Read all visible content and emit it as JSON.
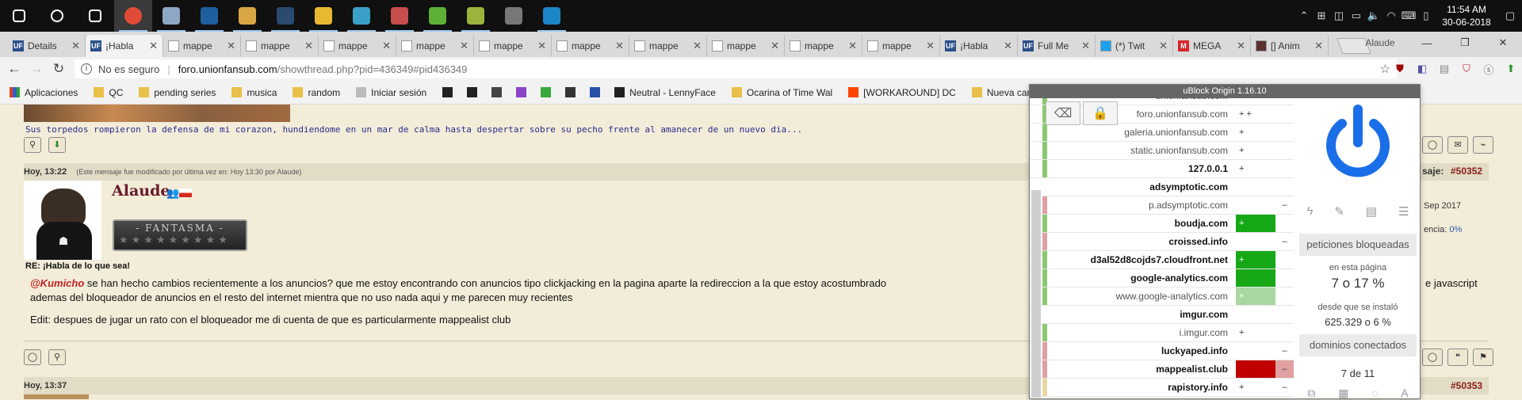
{
  "taskbar": {
    "apps": [
      {
        "icon": "windows-start-icon",
        "color": "#ffffff"
      },
      {
        "icon": "search-icon",
        "color": "#ffffff"
      },
      {
        "icon": "task-view-icon",
        "color": "#ffffff"
      },
      {
        "icon": "chrome-icon",
        "color": "#e04b36"
      },
      {
        "icon": "app-icon",
        "color": "#8fa7c6"
      },
      {
        "icon": "app-icon",
        "color": "#1f5fa0"
      },
      {
        "icon": "paint-icon",
        "color": "#d9a645"
      },
      {
        "icon": "steam-icon",
        "color": "#2a4a6e"
      },
      {
        "icon": "explorer-icon",
        "color": "#e8b930"
      },
      {
        "icon": "app-icon",
        "color": "#3ba0c8"
      },
      {
        "icon": "app-icon",
        "color": "#c84d4d"
      },
      {
        "icon": "utorrent-icon",
        "color": "#5db037"
      },
      {
        "icon": "app-icon",
        "color": "#9ab43c"
      },
      {
        "icon": "app-icon",
        "color": "#777777"
      },
      {
        "icon": "app-icon",
        "color": "#1a86c8"
      }
    ],
    "clock": {
      "time": "11:54 AM",
      "date": "30-06-2018"
    }
  },
  "tabs": [
    {
      "label": "Details",
      "fav": "UF",
      "fav_color": "#2b4f8a",
      "active": false
    },
    {
      "label": "¡Habla",
      "fav": "UF",
      "fav_color": "#2b4f8a",
      "active": true
    },
    {
      "label": "mappe",
      "fav": "",
      "fav_color": "#ffffff",
      "active": false
    },
    {
      "label": "mappe",
      "fav": "",
      "fav_color": "#ffffff",
      "active": false
    },
    {
      "label": "mappe",
      "fav": "",
      "fav_color": "#ffffff",
      "active": false
    },
    {
      "label": "mappe",
      "fav": "",
      "fav_color": "#ffffff",
      "active": false
    },
    {
      "label": "mappe",
      "fav": "",
      "fav_color": "#ffffff",
      "active": false
    },
    {
      "label": "mappe",
      "fav": "",
      "fav_color": "#ffffff",
      "active": false
    },
    {
      "label": "mappe",
      "fav": "",
      "fav_color": "#ffffff",
      "active": false
    },
    {
      "label": "mappe",
      "fav": "",
      "fav_color": "#ffffff",
      "active": false
    },
    {
      "label": "mappe",
      "fav": "",
      "fav_color": "#ffffff",
      "active": false
    },
    {
      "label": "mappe",
      "fav": "",
      "fav_color": "#ffffff",
      "active": false
    },
    {
      "label": "¡Habla",
      "fav": "UF",
      "fav_color": "#2b4f8a",
      "active": false
    },
    {
      "label": "Full Me",
      "fav": "UF",
      "fav_color": "#2b4f8a",
      "active": false
    },
    {
      "label": "(*) Twit",
      "fav": "",
      "fav_color": "#1da1f2",
      "active": false
    },
    {
      "label": "MEGA",
      "fav": "M",
      "fav_color": "#d9272e",
      "active": false
    },
    {
      "label": "[] Anim",
      "fav": "",
      "fav_color": "#5a3030",
      "active": false
    }
  ],
  "window": {
    "profile": "Alaude"
  },
  "address": {
    "security": "No es seguro",
    "domain": "foro.unionfansub.com",
    "path": "/showthread.php?pid=436349#pid436349"
  },
  "bookmarks": [
    {
      "label": "Aplicaciones",
      "color": "#e0a020"
    },
    {
      "label": "QC",
      "color": "#e8c04a"
    },
    {
      "label": "pending series",
      "color": "#e8c04a"
    },
    {
      "label": "musica",
      "color": "#e8c04a"
    },
    {
      "label": "random",
      "color": "#e8c04a"
    },
    {
      "label": "Iniciar sesión",
      "color": "#bbbbbb"
    },
    {
      "label": "",
      "color": "#222222"
    },
    {
      "label": "",
      "color": "#222222"
    },
    {
      "label": "",
      "color": "#444444"
    },
    {
      "label": "",
      "color": "#8b45c8"
    },
    {
      "label": "",
      "color": "#3aa83a"
    },
    {
      "label": "",
      "color": "#333333"
    },
    {
      "label": "",
      "color": "#2a50a8"
    },
    {
      "label": "Neutral - LennyFace",
      "color": "#222222"
    },
    {
      "label": "Ocarina of Time Wal",
      "color": "#e8c04a"
    },
    {
      "label": "[WORKAROUND] DC",
      "color": "#ff4500"
    },
    {
      "label": "Nueva carpe",
      "color": "#e8c04a"
    }
  ],
  "forum": {
    "signature_quote": "Sus torpedos rompieron la defensa de mi corazon, hundiendome en un mar de calma hasta despertar sobre su pecho frente al amanecer de un nuevo dia...",
    "post_time": "Hoy, 13:22",
    "edit_note": "(Este mensaje fue modificado por última vez en: Hoy 13:30 por Alaude)",
    "username": "Alaude",
    "rank": "- FANTASMA -",
    "post_subject": "RE: ¡Habla de lo que sea!",
    "mention": "@Kumicho",
    "line1": " se han hecho cambios recientemente a los anuncios? que me estoy encontrando con anuncios tipo clickjacking en la pagina aparte la redireccion a la que estoy acostumbrado",
    "line1_tail": "e javascript",
    "line2": "ademas del bloqueador de anuncios en el resto del internet mientra que no uso nada aqui y me parecen muy recientes",
    "line3": "Edit: despues de jugar un rato con el bloqueador me di cuenta de que es particularmente mappealist club",
    "post_num_label": "saje:",
    "post_num": "#50352",
    "joined": "Sep 2017",
    "rep_label": "encia:",
    "rep_value": "0%",
    "next_time": "Hoy, 13:37",
    "next_num": "#50353"
  },
  "ublock": {
    "title": "uBlock Origin 1.16.10",
    "domains": [
      {
        "name": "unionfansub.com",
        "bold": false,
        "bar": "#8cc870",
        "c1": "",
        "c1bg": "",
        "c2": "",
        "c2bg": ""
      },
      {
        "name": "foro.unionfansub.com",
        "bold": false,
        "bar": "#8cc870",
        "c1": "+ +",
        "c1bg": "",
        "c2": "",
        "c2bg": ""
      },
      {
        "name": "galeria.unionfansub.com",
        "bold": false,
        "bar": "#8cc870",
        "c1": "+",
        "c1bg": "",
        "c2": "",
        "c2bg": ""
      },
      {
        "name": "static.unionfansub.com",
        "bold": false,
        "bar": "#8cc870",
        "c1": "+",
        "c1bg": "",
        "c2": "",
        "c2bg": ""
      },
      {
        "name": "127.0.0.1",
        "bold": true,
        "bar": "#8cc870",
        "c1": "+",
        "c1bg": "",
        "c2": "",
        "c2bg": ""
      },
      {
        "name": "adsymptotic.com",
        "bold": true,
        "bar": "",
        "c1": "",
        "c1bg": "",
        "c2": "",
        "c2bg": ""
      },
      {
        "name": "p.adsymptotic.com",
        "bold": false,
        "bar": "#e0a0a0",
        "c1": "",
        "c1bg": "",
        "c2": "–",
        "c2bg": ""
      },
      {
        "name": "boudja.com",
        "bold": true,
        "bar": "#8cc870",
        "c1": "+",
        "c1bg": "#16a816",
        "c2": "",
        "c2bg": ""
      },
      {
        "name": "croissed.info",
        "bold": true,
        "bar": "#e0a0a0",
        "c1": "",
        "c1bg": "",
        "c2": "–",
        "c2bg": ""
      },
      {
        "name": "d3al52d8cojds7.cloudfront.net",
        "bold": true,
        "bar": "#8cc870",
        "c1": "+",
        "c1bg": "#16a816",
        "c2": "",
        "c2bg": ""
      },
      {
        "name": "google-analytics.com",
        "bold": true,
        "bar": "#8cc870",
        "c1": "",
        "c1bg": "#16a816",
        "c2": "",
        "c2bg": ""
      },
      {
        "name": "www.google-analytics.com",
        "bold": false,
        "bar": "#8cc870",
        "c1": "+",
        "c1bg": "#a8d8a0",
        "c2": "",
        "c2bg": ""
      },
      {
        "name": "imgur.com",
        "bold": true,
        "bar": "",
        "c1": "",
        "c1bg": "",
        "c2": "",
        "c2bg": ""
      },
      {
        "name": "i.imgur.com",
        "bold": false,
        "bar": "#8cc870",
        "c1": "+",
        "c1bg": "",
        "c2": "",
        "c2bg": ""
      },
      {
        "name": "luckyaped.info",
        "bold": true,
        "bar": "#e0a0a0",
        "c1": "",
        "c1bg": "",
        "c2": "–",
        "c2bg": ""
      },
      {
        "name": "mappealist.club",
        "bold": true,
        "bar": "#e0a0a0",
        "c1": "",
        "c1bg": "#c00000",
        "c2": "–",
        "c2bg": "#e0a0a0"
      },
      {
        "name": "rapistory.info",
        "bold": true,
        "bar": "#e8d8a0",
        "c1": "+",
        "c1bg": "",
        "c2": "–",
        "c2bg": ""
      }
    ],
    "blocked_label": "peticiones bloqueadas",
    "on_page_label": "en esta página",
    "on_page_value": "7 o 17 %",
    "since_label": "desde que se instaló",
    "since_value": "625.329 o 6 %",
    "connected_label": "dominios conectados",
    "connected_value": "7 de 11",
    "accent": "#1a6fe8"
  }
}
